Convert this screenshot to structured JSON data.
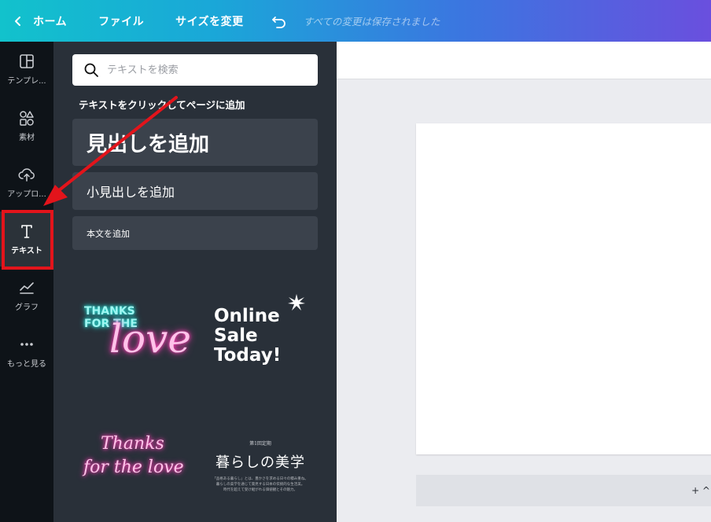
{
  "topbar": {
    "home": "ホーム",
    "file": "ファイル",
    "resize": "サイズを変更",
    "status": "すべての変更は保存されました"
  },
  "rail": {
    "items": [
      {
        "label": "テンプレ...",
        "icon": "template-icon"
      },
      {
        "label": "素材",
        "icon": "elements-icon"
      },
      {
        "label": "アップロ...",
        "icon": "upload-cloud-icon"
      },
      {
        "label": "テキスト",
        "icon": "text-icon"
      },
      {
        "label": "グラフ",
        "icon": "chart-icon"
      },
      {
        "label": "もっと見る",
        "icon": "more-dots-icon"
      }
    ]
  },
  "panel": {
    "search_placeholder": "テキストを検索",
    "heading": "テキストをクリックしてページに追加",
    "add_heading": "見出しを追加",
    "add_subheading": "小見出しを追加",
    "add_body": "本文を追加",
    "tiles": {
      "neon_top": "THANKS\nFOR THE",
      "neon_script": "love",
      "online_sale": "Online\nSale\nToday!",
      "script_line1": "Thanks",
      "script_line2": "for the love",
      "kurashi_small": "第1回定期",
      "kurashi_title": "暮らしの美学",
      "kurashi_fine": "「品格ある暮らし」とは、豊かさを求める日々の積み重ね。\n暮らしの美学を通じて発見する日本の伝統的な生活美。\n時代を超えて受け継がれる価値観とその魅力。"
    }
  },
  "editor": {
    "add_page": "+ ^"
  },
  "colors": {
    "accent_red": "#e3141b",
    "rail_bg": "#0e1318",
    "panel_bg": "#293039"
  }
}
